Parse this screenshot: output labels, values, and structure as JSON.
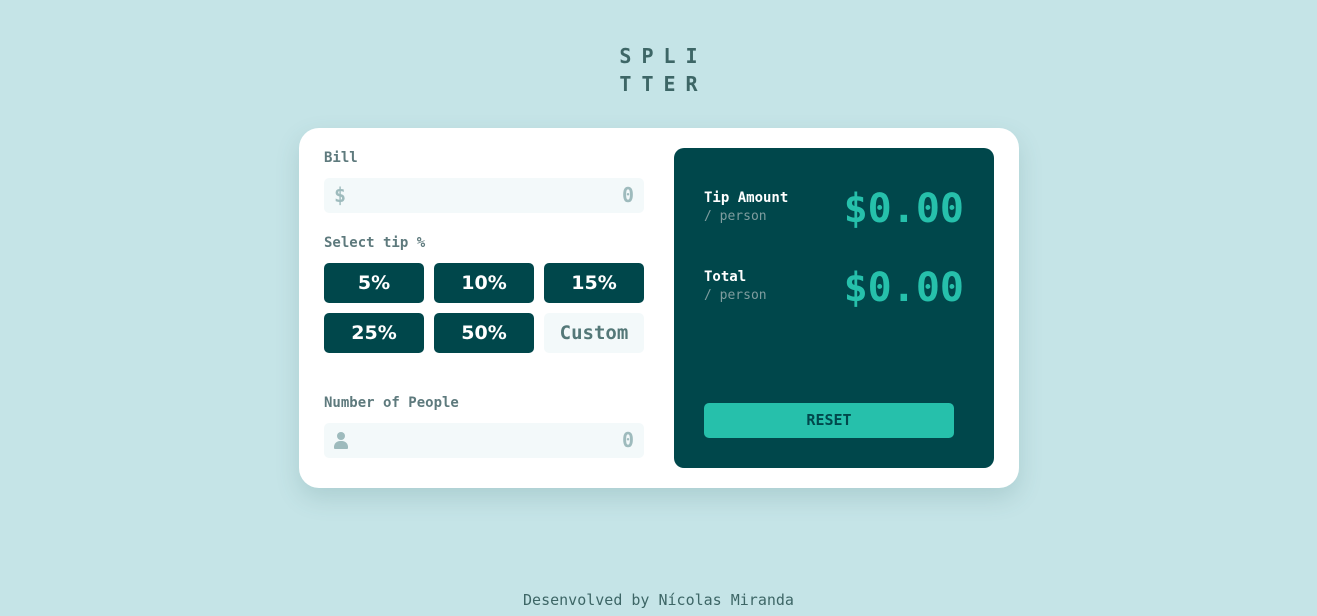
{
  "logo": {
    "line1": "SPLI",
    "line2": "TTER"
  },
  "bill": {
    "label": "Bill",
    "currency_symbol": "$",
    "placeholder": "0"
  },
  "tip": {
    "label": "Select tip %",
    "options": [
      "5%",
      "10%",
      "15%",
      "25%",
      "50%"
    ],
    "custom_placeholder": "Custom"
  },
  "people": {
    "label": "Number of People",
    "placeholder": "0",
    "icon": "person-icon"
  },
  "results": {
    "tip_amount": {
      "label": "Tip Amount",
      "sub": "/ person",
      "value": "$0.00"
    },
    "total": {
      "label": "Total",
      "sub": "/ person",
      "value": "$0.00"
    },
    "reset_label": "RESET"
  },
  "footer": {
    "text": "Desenvolved by Nícolas Miranda"
  },
  "colors": {
    "background": "#c5e4e7",
    "dark_cyan": "#00474b",
    "strong_cyan": "#26c0ab",
    "input_bg": "#f3f9fa"
  }
}
